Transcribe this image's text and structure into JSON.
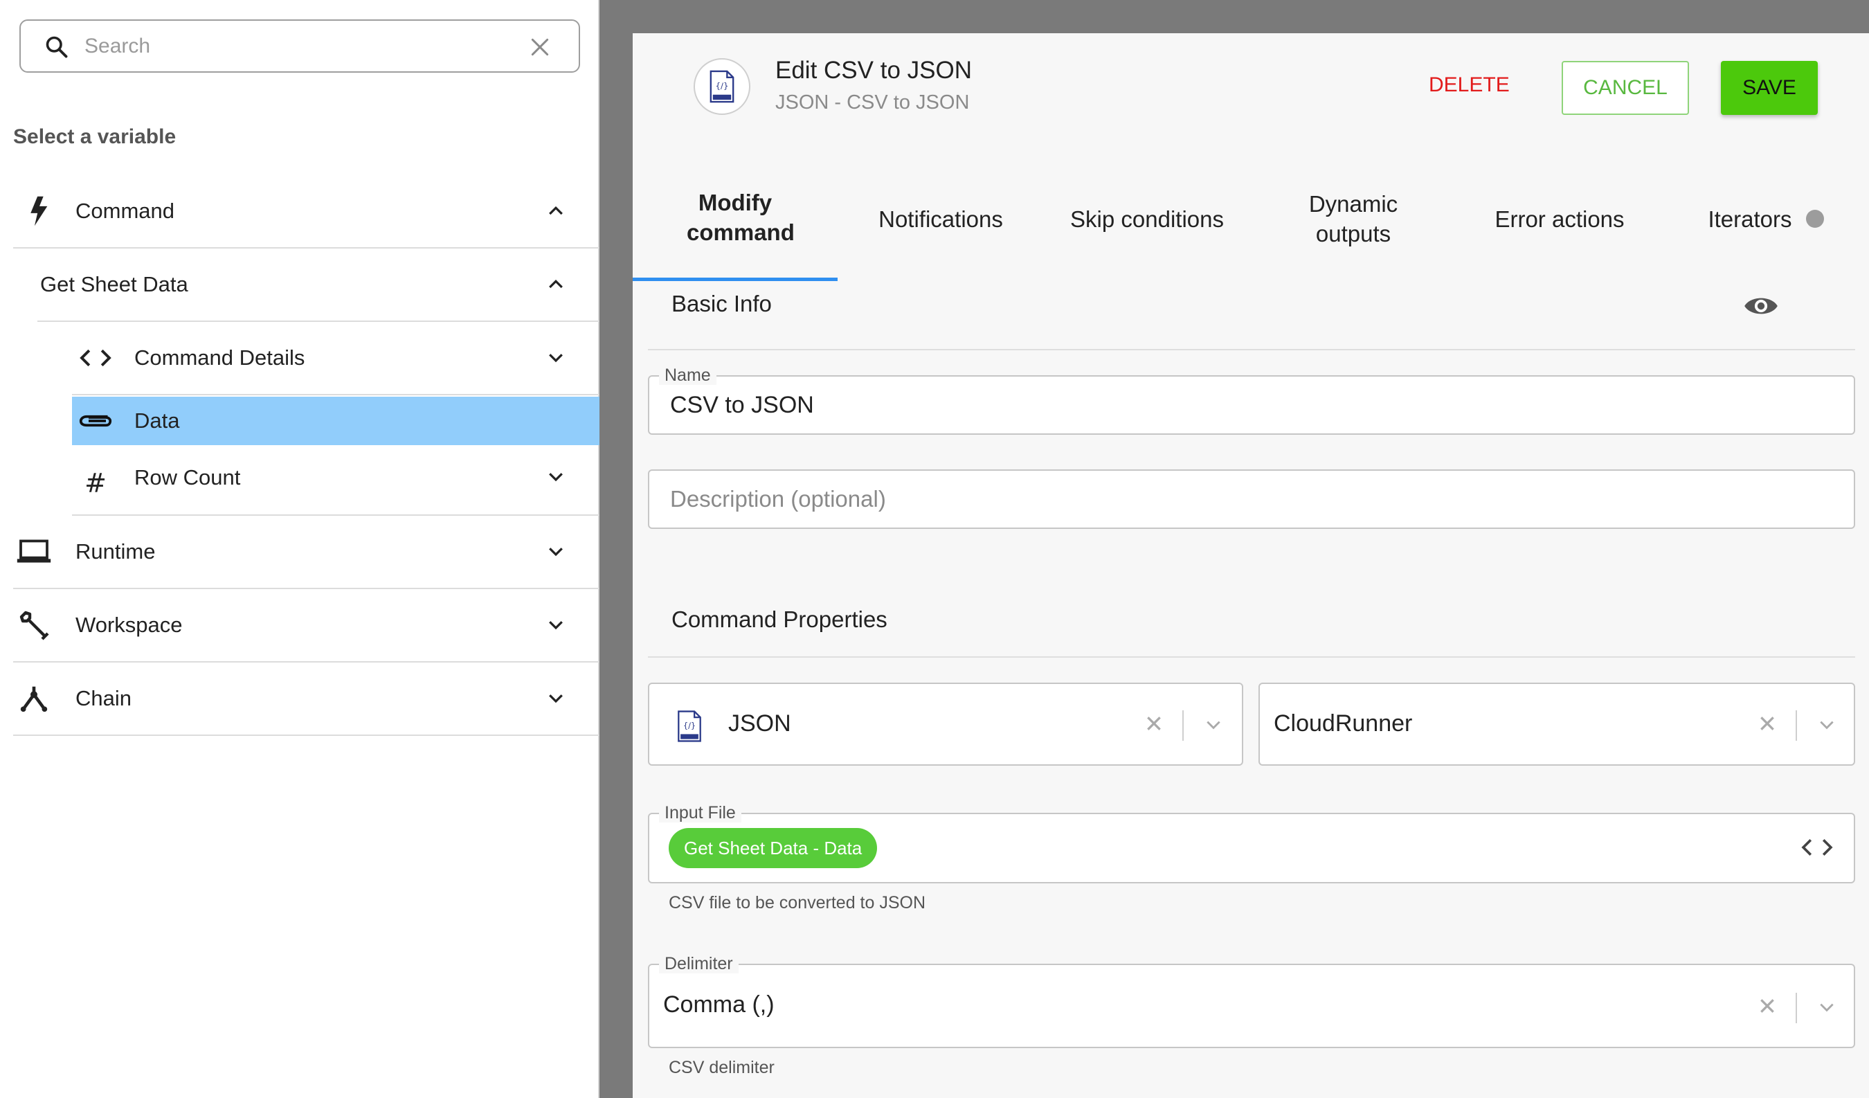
{
  "search": {
    "placeholder": "Search",
    "value": ""
  },
  "picker": {
    "title": "Select a variable",
    "items": [
      {
        "label": "Command",
        "icon": "lightning-icon",
        "expanded": true
      },
      {
        "label": "Get Sheet Data",
        "expanded": true
      },
      {
        "label": "Command Details",
        "icon": "code-icon",
        "expanded": false
      },
      {
        "label": "Data",
        "icon": "paperclip-icon",
        "selected": true
      },
      {
        "label": "Row Count",
        "icon": "hash-icon",
        "expanded": false
      },
      {
        "label": "Runtime",
        "icon": "laptop-icon",
        "expanded": false
      },
      {
        "label": "Workspace",
        "icon": "wrench-icon",
        "expanded": false
      },
      {
        "label": "Chain",
        "icon": "chain-icon",
        "expanded": false
      }
    ]
  },
  "editor": {
    "title": "Edit CSV to JSON",
    "subtitle": "JSON - CSV to JSON",
    "icon": "json-file-icon",
    "delete_label": "DELETE",
    "cancel_label": "CANCEL",
    "save_label": "SAVE",
    "tabs": [
      {
        "label": "Modify command",
        "active": true
      },
      {
        "label": "Notifications"
      },
      {
        "label": "Skip conditions"
      },
      {
        "label": "Dynamic outputs"
      },
      {
        "label": "Error actions"
      },
      {
        "label": "Iterators"
      }
    ],
    "basic_info": {
      "title": "Basic Info",
      "name_label": "Name",
      "name_value": "CSV to JSON",
      "description_placeholder": "Description (optional)"
    },
    "command_properties": {
      "title": "Command Properties",
      "integration": "JSON",
      "runner": "CloudRunner",
      "input_file_label": "Input File",
      "input_file_chip": "Get Sheet Data - Data",
      "input_file_helper": "CSV file to be converted to JSON",
      "delimiter_label": "Delimiter",
      "delimiter_value": "Comma (,)",
      "delimiter_helper": "CSV delimiter"
    }
  },
  "colors": {
    "selected_row": "#91cdfb",
    "save_button": "#4cc90c",
    "delete_text": "#e21b1b",
    "chip": "#58cc3a",
    "active_tab": "#2f8ff0"
  }
}
